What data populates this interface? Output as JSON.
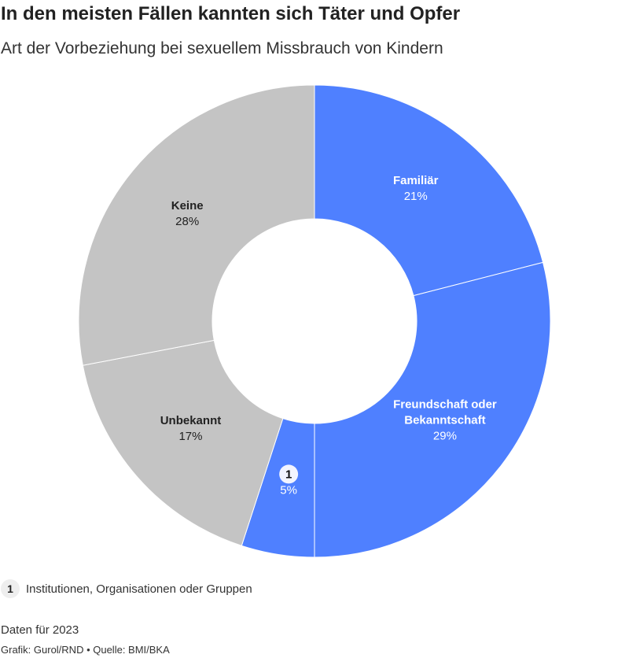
{
  "title": "In den meisten Fällen kannten sich Täter und Opfer",
  "subtitle": "Art der Vorbeziehung bei sexuellem Missbrauch von Kindern",
  "legend": {
    "marker": "1",
    "text": "Institutionen, Organisationen oder Gruppen"
  },
  "note": "Daten für 2023",
  "source": "Grafik: Gurol/RND • Quelle: BMI/BKA",
  "chart_data": {
    "type": "pie",
    "donut": true,
    "slices": [
      {
        "label": "Familiär",
        "value": 21,
        "value_label": "21%",
        "color": "#4f80ff",
        "text_color": "#ffffff"
      },
      {
        "label": "Freundschaft oder Bekanntschaft",
        "value": 29,
        "value_label": "29%",
        "color": "#4f80ff",
        "text_color": "#ffffff"
      },
      {
        "label": "1",
        "value": 5,
        "value_label": "5%",
        "color": "#4f80ff",
        "text_color": "#ffffff",
        "badge": true
      },
      {
        "label": "Unbekannt",
        "value": 17,
        "value_label": "17%",
        "color": "#c4c4c4",
        "text_color": "#222222"
      },
      {
        "label": "Keine",
        "value": 28,
        "value_label": "28%",
        "color": "#c4c4c4",
        "text_color": "#222222"
      }
    ]
  }
}
